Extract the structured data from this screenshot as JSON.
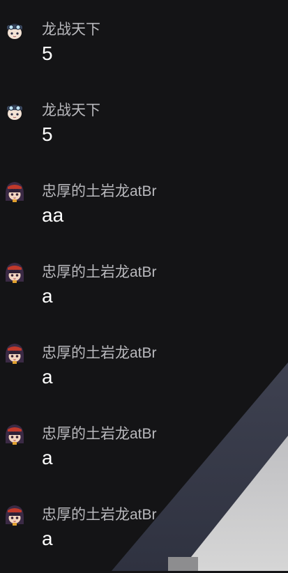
{
  "messages": [
    {
      "user": "龙战天下",
      "text": "5",
      "avatar": "goggles-avatar-icon"
    },
    {
      "user": "龙战天下",
      "text": "5",
      "avatar": "goggles-avatar-icon"
    },
    {
      "user": "忠厚的土岩龙atBr",
      "text": "aa",
      "avatar": "hooded-girl-avatar-icon"
    },
    {
      "user": "忠厚的土岩龙atBr",
      "text": "a",
      "avatar": "hooded-girl-avatar-icon"
    },
    {
      "user": "忠厚的土岩龙atBr",
      "text": "a",
      "avatar": "hooded-girl-avatar-icon"
    },
    {
      "user": "忠厚的土岩龙atBr",
      "text": "a",
      "avatar": "hooded-girl-avatar-icon"
    },
    {
      "user": "忠厚的土岩龙atBr",
      "text": "a",
      "avatar": "hooded-girl-avatar-icon"
    }
  ],
  "colors": {
    "background": "#141416",
    "username": "#b9b9bd",
    "message": "#ffffff",
    "terrain_slope": "#3a3d4a",
    "terrain_floor": "#c9c9c9"
  }
}
